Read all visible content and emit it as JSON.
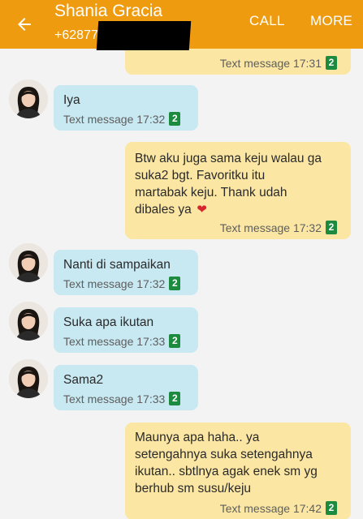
{
  "header": {
    "contact_name": "Shania Gracia",
    "contact_number": "+62877",
    "call_label": "CALL",
    "more_label": "MORE"
  },
  "colors": {
    "appbar": "#ef9b0f",
    "incoming_bubble": "#c8e9f2",
    "outgoing_bubble": "#fbe7a3",
    "sim_badge": "#1c8a3f",
    "background": "#f3f3f3"
  },
  "messages": [
    {
      "direction": "outgoing",
      "text": "",
      "meta": "Text message 17:31",
      "sim": "2"
    },
    {
      "direction": "incoming",
      "text": "Iya",
      "meta": "Text message 17:32",
      "sim": "2"
    },
    {
      "direction": "outgoing",
      "text": "Btw aku juga sama keju walau ga\nsuka2 bgt. Favoritku itu\nmartabak keju. Thank udah\ndibales ya",
      "emoji": "❤",
      "meta": "Text message 17:32",
      "sim": "2"
    },
    {
      "direction": "incoming",
      "text": "Nanti di sampaikan",
      "meta": "Text message 17:32",
      "sim": "2"
    },
    {
      "direction": "incoming",
      "text": "Suka apa ikutan",
      "meta": "Text message 17:33",
      "sim": "2"
    },
    {
      "direction": "incoming",
      "text": "Sama2",
      "meta": "Text message 17:33",
      "sim": "2"
    },
    {
      "direction": "outgoing",
      "text": "Maunya apa haha.. ya\nsetengahnya suka setengahnya\nikutan.. sbtlnya agak enek sm yg\nberhub sm susu/keju",
      "meta": "Text message 17:42",
      "sim": "2"
    }
  ]
}
